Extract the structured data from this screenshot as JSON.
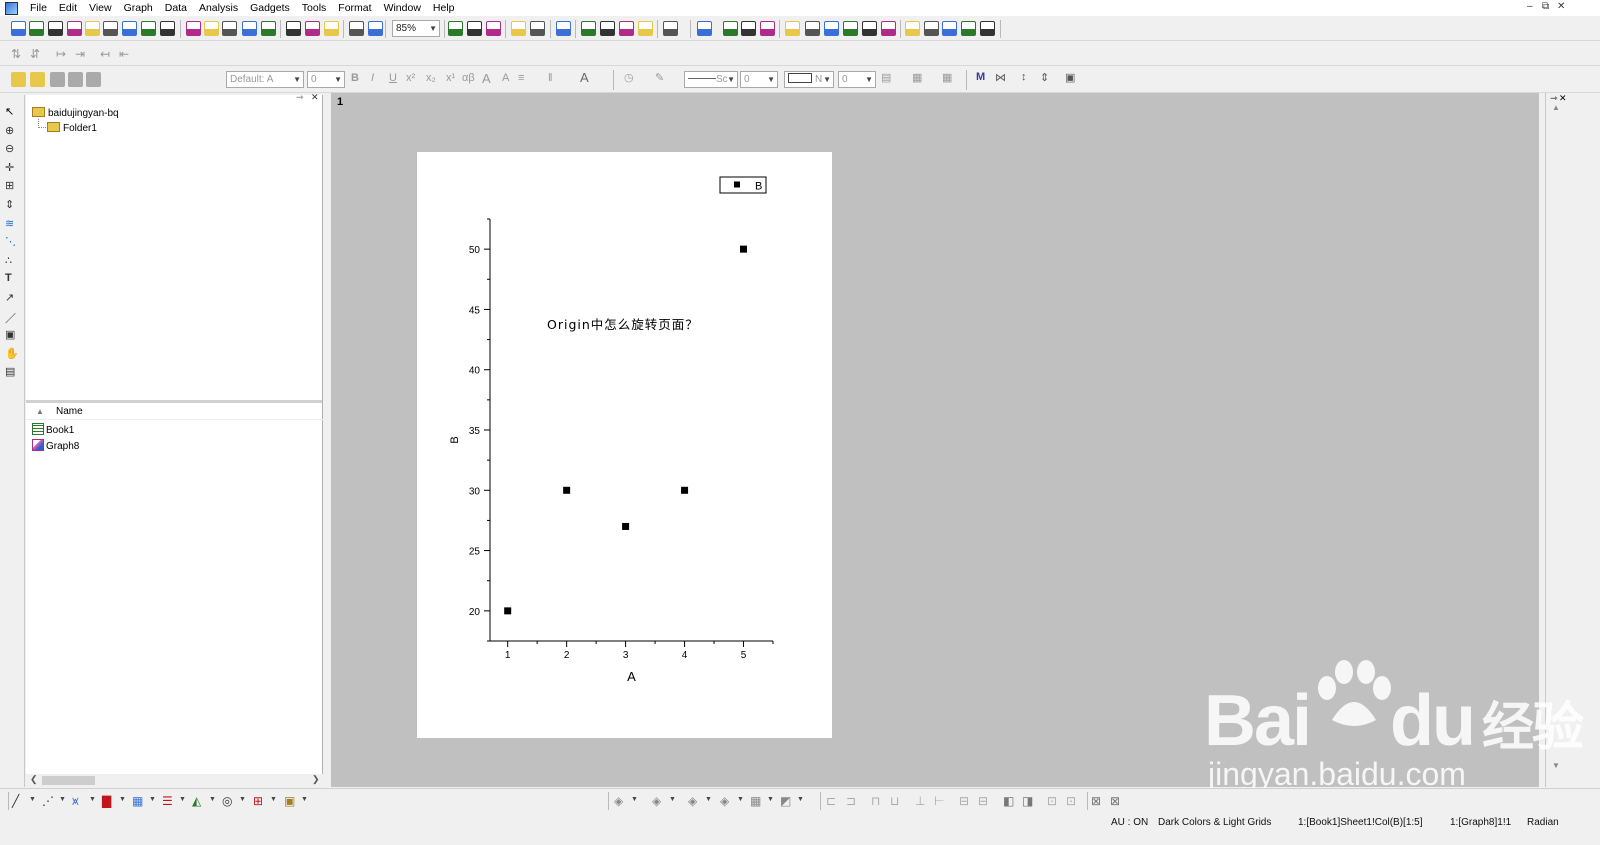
{
  "menu": [
    "File",
    "Edit",
    "View",
    "Graph",
    "Data",
    "Analysis",
    "Gadgets",
    "Tools",
    "Format",
    "Window",
    "Help"
  ],
  "toolbar": {
    "zoom": "85%",
    "font_combo": "Default: A",
    "font_size": "0",
    "line_style": "Sc",
    "line_width": "0",
    "fill_label": "N",
    "fill_value": "0"
  },
  "left_tools": [
    "pointer-icon",
    "zoom-in-icon",
    "zoom-out-icon",
    "scale-icon",
    "data-reader-icon",
    "screen-reader-icon",
    "draw-data-icon",
    "mask-icon",
    "regional-select-icon",
    "text-tool-icon",
    "arrow-tool-icon",
    "line-tool-icon",
    "rectangle-tool-icon",
    "pan-icon",
    "insert-graph-icon"
  ],
  "explorer": {
    "root_folder": "baidujingyan-bq",
    "subfolder": "Folder1",
    "name_header": "Name",
    "items": [
      {
        "name": "Book1",
        "icon": "workbook-icon"
      },
      {
        "name": "Graph8",
        "icon": "graph-window-icon"
      }
    ]
  },
  "graph": {
    "layer_label": "1",
    "annotation": "Origin中怎么旋转页面？"
  },
  "chart_data": {
    "type": "scatter",
    "x": [
      1,
      2,
      3,
      4,
      5
    ],
    "series": [
      {
        "name": "B",
        "values": [
          20,
          30,
          27,
          30,
          50
        ]
      }
    ],
    "xlabel": "A",
    "ylabel": "B",
    "xlim": [
      0.7,
      5.5
    ],
    "ylim": [
      17.5,
      52.5
    ],
    "xticks": [
      "1",
      "2",
      "3",
      "4",
      "5"
    ],
    "yticks": [
      "20",
      "25",
      "30",
      "35",
      "40",
      "45",
      "50"
    ],
    "legend_position": "top-right",
    "grid": false,
    "marker": "square",
    "color": "#000000"
  },
  "status": {
    "au": "AU : ON",
    "theme": "Dark Colors & Light Grids",
    "active_col": "1:[Book1]Sheet1!Col(B)[1:5]",
    "active_graph": "1:[Graph8]1!1",
    "angle": "Radian"
  },
  "watermark": {
    "brand": "Bai",
    "brand_tail": "du",
    "cn": "经验",
    "url": "jingyan.baidu.com"
  },
  "colors": {
    "workspace": "#c0c0c0",
    "page": "#ffffff",
    "accent_blue": "#3a6fd8"
  }
}
